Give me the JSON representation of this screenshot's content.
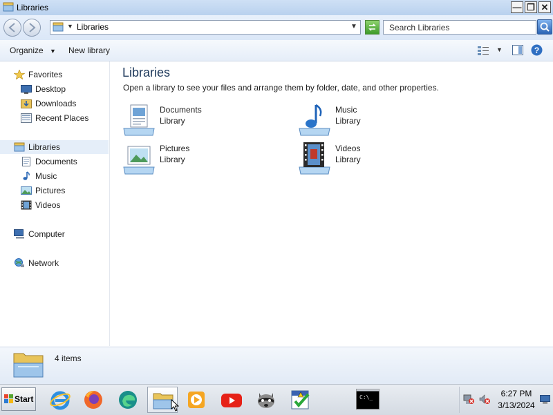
{
  "window": {
    "title": "Libraries",
    "minimize_glyph": "—",
    "restore_glyph": "❐",
    "close_glyph": "✕"
  },
  "address": {
    "path": "Libraries",
    "search_placeholder": "Search Libraries"
  },
  "toolbar": {
    "organize_label": "Organize",
    "new_library_label": "New library"
  },
  "sidebar": {
    "favorites": {
      "label": "Favorites",
      "items": [
        {
          "label": "Desktop",
          "icon": "desktop-icon"
        },
        {
          "label": "Downloads",
          "icon": "downloads-icon"
        },
        {
          "label": "Recent Places",
          "icon": "recent-places-icon"
        }
      ]
    },
    "libraries": {
      "label": "Libraries",
      "items": [
        {
          "label": "Documents",
          "icon": "documents-icon"
        },
        {
          "label": "Music",
          "icon": "music-icon"
        },
        {
          "label": "Pictures",
          "icon": "pictures-icon"
        },
        {
          "label": "Videos",
          "icon": "videos-icon"
        }
      ]
    },
    "computer": {
      "label": "Computer"
    },
    "network": {
      "label": "Network"
    }
  },
  "main": {
    "title": "Libraries",
    "subtitle": "Open a library to see your files and arrange them by folder, date, and other properties.",
    "libraries": [
      {
        "name": "Documents",
        "type": "Library",
        "icon": "documents-library-icon"
      },
      {
        "name": "Music",
        "type": "Library",
        "icon": "music-library-icon"
      },
      {
        "name": "Pictures",
        "type": "Library",
        "icon": "pictures-library-icon"
      },
      {
        "name": "Videos",
        "type": "Library",
        "icon": "videos-library-icon"
      }
    ]
  },
  "details": {
    "item_count": "4 items"
  },
  "taskbar": {
    "start_label": "Start",
    "apps": [
      "internet-explorer-icon",
      "firefox-icon",
      "edge-icon",
      "explorer-icon",
      "media-player-icon",
      "youtube-icon",
      "raccoon-icon",
      "checklist-icon",
      "command-prompt-icon"
    ],
    "cmd_text": "C:\\_",
    "time": "6:27 PM",
    "date": "3/13/2024"
  },
  "colors": {
    "accent": "#1e395b",
    "selection": "#e5eef9"
  }
}
